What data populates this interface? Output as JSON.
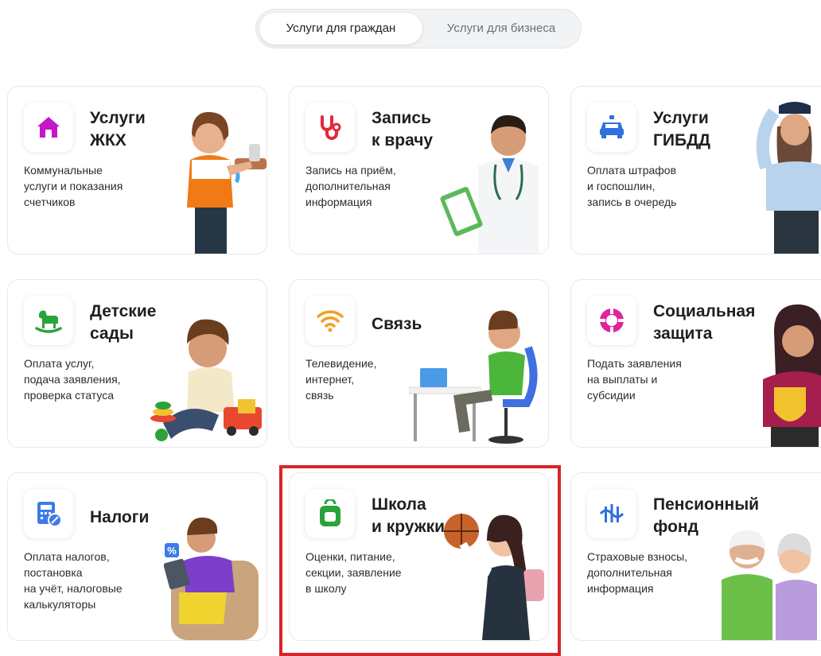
{
  "tabs": {
    "citizens": "Услуги для граждан",
    "business": "Услуги для бизнеса",
    "active": "citizens"
  },
  "cards": [
    {
      "title": "Услуги\nЖКХ",
      "desc": "Коммунальные\nуслуги и показания\nсчетчиков",
      "icon": "house-icon",
      "icon_color": "#c516c9"
    },
    {
      "title": "Запись\nк врачу",
      "desc": "Запись на приём,\nдополнительная\nинформация",
      "icon": "stethoscope-icon",
      "icon_color": "#e5273a"
    },
    {
      "title": "Услуги\nГИБДД",
      "desc": "Оплата штрафов\nи госпошлин,\nзапись в очередь",
      "icon": "police-car-icon",
      "icon_color": "#2f6fe0"
    },
    {
      "title": "Детские\nсады",
      "desc": "Оплата услуг,\nподача заявления,\nпроверка статуса",
      "icon": "rocking-horse-icon",
      "icon_color": "#2aa33c"
    },
    {
      "title": "Связь",
      "desc": "Телевидение,\nинтернет,\nсвязь",
      "icon": "wifi-icon",
      "icon_color": "#f2a01d"
    },
    {
      "title": "Социальная\nзащита",
      "desc": "Подать заявления\nна выплаты и\nсубсидии",
      "icon": "lifebuoy-icon",
      "icon_color": "#e0249c"
    },
    {
      "title": "Налоги",
      "desc": "Оплата налогов,\nпостановка\nна учёт, налоговые\nкалькуляторы",
      "icon": "calculator-icon",
      "icon_color": "#3e7be6"
    },
    {
      "title": "Школа\nи кружки",
      "desc": "Оценки, питание,\nсекции, заявление\nв школу",
      "icon": "backpack-icon",
      "icon_color": "#2aa33c"
    },
    {
      "title": "Пенсионный\nфонд",
      "desc": "Страховые взносы,\nдополнительная\nинформация",
      "icon": "pension-fund-icon",
      "icon_color": "#2f6fe0"
    }
  ],
  "illustrations": [
    "woman-at-tap-illustration",
    "doctor-illustration",
    "traffic-officer-illustration",
    "boy-with-toys-illustration",
    "man-at-desk-illustration",
    "woman-with-shield-illustration",
    "man-with-tablet-illustration",
    "girl-with-basketball-illustration",
    "elderly-couple-illustration"
  ],
  "tax_badge": "%"
}
